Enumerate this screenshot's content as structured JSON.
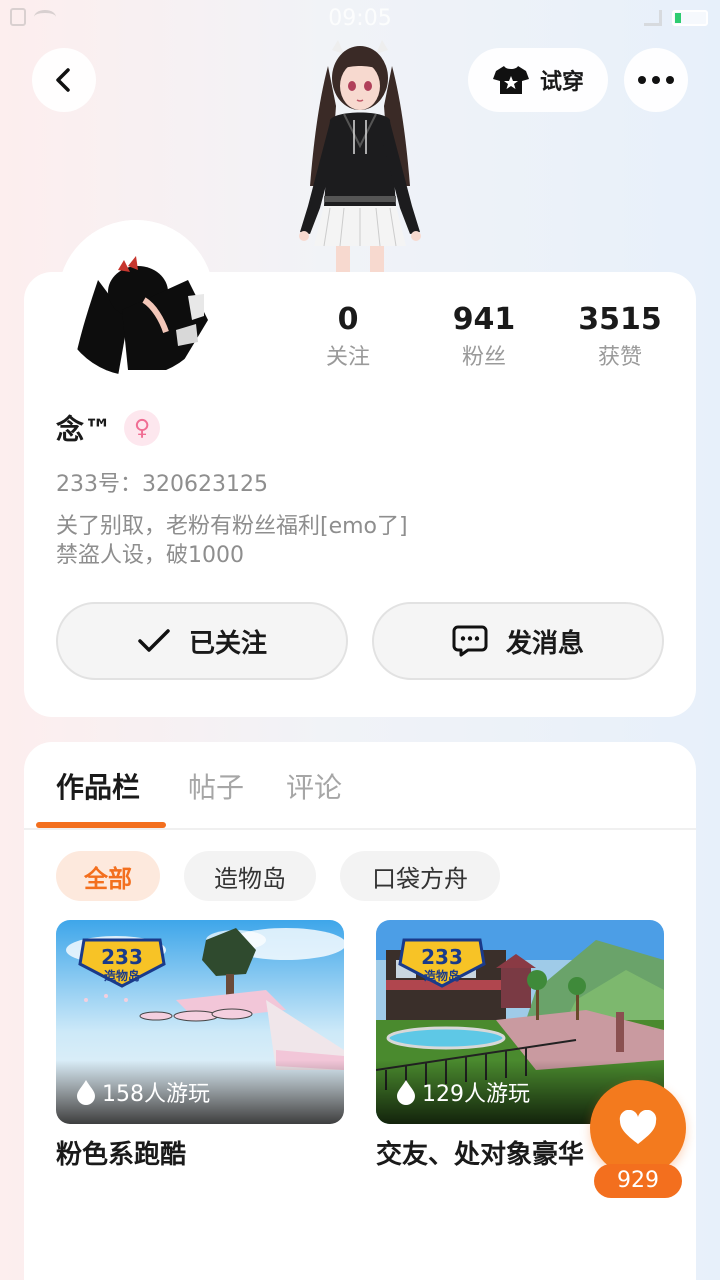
{
  "status_bar": {
    "time": "09:05"
  },
  "nav": {
    "try_on_label": "试穿"
  },
  "profile": {
    "name": "念™",
    "gender_symbol": "♀",
    "uid": "233号：320623125",
    "bio_line1": "关了别取，老粉有粉丝福利[emo了]",
    "bio_line2": "禁盗人设，破1000",
    "stats": [
      {
        "value": "0",
        "label": "关注"
      },
      {
        "value": "941",
        "label": "粉丝"
      },
      {
        "value": "3515",
        "label": "获赞"
      }
    ],
    "follow_label": "已关注",
    "message_label": "发消息"
  },
  "tabs": [
    {
      "label": "作品栏",
      "active": true
    },
    {
      "label": "帖子",
      "active": false
    },
    {
      "label": "评论",
      "active": false
    }
  ],
  "filters": [
    {
      "label": "全部",
      "active": true
    },
    {
      "label": "造物岛",
      "active": false
    },
    {
      "label": "口袋方舟",
      "active": false
    }
  ],
  "games": [
    {
      "title": "粉色系跑酷",
      "plays": "158人游玩",
      "logo_text": "233",
      "logo_sub": "造物岛"
    },
    {
      "title": "交友、处对象豪华",
      "plays": "129人游玩",
      "logo_text": "233",
      "logo_sub": "造物岛"
    }
  ],
  "like": {
    "count": "929"
  },
  "colors": {
    "accent": "#f36f1e",
    "gender_pink": "#f06d93"
  }
}
